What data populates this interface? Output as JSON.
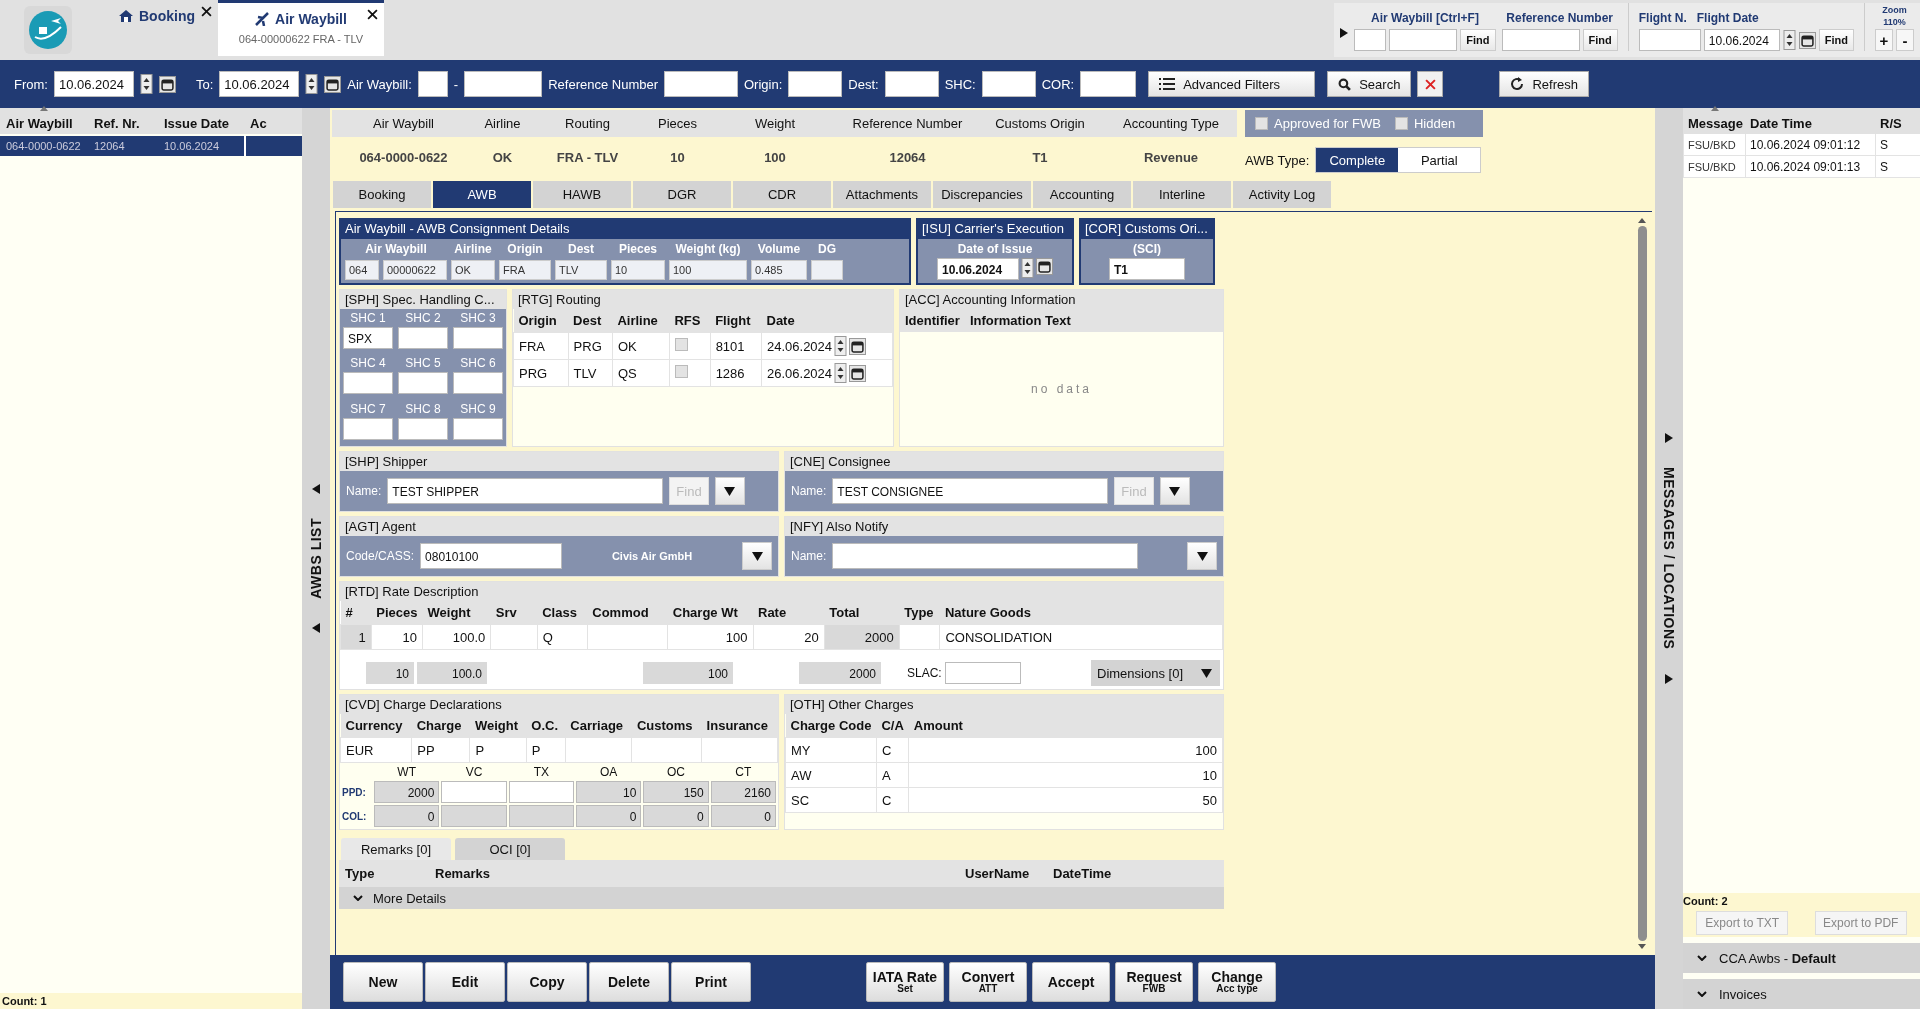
{
  "app_tabs": [
    {
      "kind": "booking",
      "label": "Booking",
      "selected": false
    },
    {
      "kind": "awb",
      "label": "Air Waybill",
      "subtitle": "064-00000622 FRA - TLV",
      "selected": true
    }
  ],
  "quick_search": {
    "awb_label": "Air Waybill [Ctrl+F]",
    "ref_label": "Reference Number",
    "flight_label": "Flight N.",
    "date_label": "Flight Date",
    "date_value": "10.06.2024",
    "find_buttons": [
      "Find",
      "Find",
      "Find"
    ],
    "zoom_label": "Zoom",
    "zoom_value": "110%",
    "zoom_in": "+",
    "zoom_out": "-"
  },
  "filter_bar": {
    "from_label": "From:",
    "from": "10.06.2024",
    "to_label": "To:",
    "to": "10.06.2024",
    "awb_label": "Air Waybill:",
    "awb_dash": "-",
    "ref_label": "Reference Number",
    "origin_label": "Origin:",
    "dest_label": "Dest:",
    "shc_label": "SHC:",
    "cor_label": "COR:",
    "advanced": "Advanced Filters",
    "search": "Search",
    "refresh": "Refresh"
  },
  "awb_list": {
    "columns": [
      "Air Waybill",
      "Ref. Nr.",
      "Issue Date",
      "Ac"
    ],
    "rows": [
      {
        "awb": "064-0000-0622",
        "ref": "12064",
        "date": "10.06.2024",
        "selected": true
      }
    ],
    "count": "Count: 1",
    "splitter_label": "AWBS LIST"
  },
  "summary": {
    "columns": [
      "Air Waybill",
      "Airline",
      "Routing",
      "Pieces",
      "Weight",
      "Reference Number",
      "Customs Origin",
      "Accounting Type"
    ],
    "values": [
      "064-0000-0622",
      "OK",
      "FRA - TLV",
      "10",
      "100",
      "12064",
      "T1",
      "Revenue"
    ]
  },
  "flags": [
    {
      "label": "Approved for FWB",
      "checked": false
    },
    {
      "label": "Hidden",
      "checked": false
    }
  ],
  "awb_type": {
    "label": "AWB Type:",
    "options": [
      {
        "label": "Complete",
        "selected": true
      },
      {
        "label": "Partial",
        "selected": false
      }
    ]
  },
  "detail_tabs": [
    {
      "label": "Booking",
      "selected": false
    },
    {
      "label": "AWB",
      "selected": true
    },
    {
      "label": "HAWB",
      "selected": false
    },
    {
      "label": "DGR",
      "selected": false
    },
    {
      "label": "CDR",
      "selected": false
    },
    {
      "label": "Attachments",
      "selected": false
    },
    {
      "label": "Discrepancies",
      "selected": false
    },
    {
      "label": "Accounting",
      "selected": false
    },
    {
      "label": "Interline",
      "selected": false
    },
    {
      "label": "Activity Log",
      "selected": false
    }
  ],
  "consignment": {
    "title": "Air Waybill - AWB Consignment Details",
    "columns": [
      "Air Waybill",
      "Airline",
      "Origin",
      "Dest",
      "Pieces",
      "Weight (kg)",
      "Volume",
      "DG"
    ],
    "values": [
      "064",
      "00000622",
      "OK",
      "FRA",
      "TLV",
      "10",
      "100",
      "0.485"
    ]
  },
  "issue": {
    "title": "[ISU] Carrier's Execution",
    "label": "Date of Issue",
    "value": "10.06.2024"
  },
  "customs_origin": {
    "title": "[COR] Customs Ori...",
    "label": "(SCI)",
    "value": "T1"
  },
  "special_handling": {
    "title": "[SPH] Spec. Handling C...",
    "codes": [
      {
        "label": "SHC 1",
        "value": "SPX"
      },
      {
        "label": "SHC 2"
      },
      {
        "label": "SHC 3"
      },
      {
        "label": "SHC 4"
      },
      {
        "label": "SHC 5"
      },
      {
        "label": "SHC 6"
      },
      {
        "label": "SHC 7"
      },
      {
        "label": "SHC 8"
      },
      {
        "label": "SHC 9"
      }
    ]
  },
  "routing": {
    "title": "[RTG] Routing",
    "columns": [
      "Origin",
      "Dest",
      "Airline",
      "RFS",
      "Flight",
      "Date"
    ],
    "rows": [
      {
        "origin": "FRA",
        "dest": "PRG",
        "airline": "OK",
        "rfs": false,
        "flight": "8101",
        "date": "24.06.2024"
      },
      {
        "origin": "PRG",
        "dest": "TLV",
        "airline": "QS",
        "rfs": false,
        "flight": "1286",
        "date": "26.06.2024"
      }
    ]
  },
  "accounting": {
    "title": "[ACC] Accounting Information",
    "columns": [
      "Identifier",
      "Information Text"
    ],
    "empty": "no data"
  },
  "shipper": {
    "title": "[SHP] Shipper",
    "label": "Name:",
    "value": "TEST SHIPPER",
    "find": "Find"
  },
  "consignee": {
    "title": "[CNE] Consignee",
    "label": "Name:",
    "value": "TEST CONSIGNEE",
    "find": "Find"
  },
  "agent": {
    "title": "[AGT] Agent",
    "label": "Code/CASS:",
    "value": "08010100",
    "name": "Civis Air GmbH"
  },
  "notify": {
    "title": "[NFY] Also Notify",
    "label": "Name:"
  },
  "rates": {
    "title": "[RTD] Rate Description",
    "columns": [
      "#",
      "Pieces",
      "Weight",
      "Srv",
      "Class",
      "Commod",
      "Charge Wt",
      "Rate",
      "Total",
      "Type",
      "Nature Goods"
    ],
    "rows": [
      {
        "no": "1",
        "pieces": "10",
        "weight": "100.0",
        "class": "Q",
        "charge_wt": "100",
        "rate": "20",
        "total": "2000",
        "nature": "CONSOLIDATION"
      }
    ],
    "totals": {
      "pieces": "10",
      "weight": "100.0",
      "charge_wt": "100",
      "total": "2000"
    },
    "slac_label": "SLAC:",
    "dimensions": "Dimensions [0]"
  },
  "charges": {
    "title": "[CVD] Charge Declarations",
    "columns": [
      "Currency",
      "Charge",
      "Weight",
      "O.C.",
      "Carriage",
      "Customs",
      "Insurance"
    ],
    "values": {
      "currency": "EUR",
      "charge": "PP",
      "weight": "P",
      "oc": "P"
    },
    "summary_columns": [
      "WT",
      "VC",
      "TX",
      "OA",
      "OC",
      "CT"
    ],
    "summary_rows": [
      {
        "label": "PPD:",
        "values": {
          "wt": "2000",
          "oa": "10",
          "oc": "150",
          "ct": "2160"
        }
      },
      {
        "label": "COL:",
        "values": {
          "wt": "0",
          "oa": "0",
          "oc": "0",
          "ct": "0"
        }
      }
    ]
  },
  "other_charges": {
    "title": "[OTH] Other Charges",
    "columns": [
      "Charge Code",
      "C/A",
      "Amount"
    ],
    "rows": [
      {
        "code": "MY",
        "ca": "C",
        "amount": "100"
      },
      {
        "code": "AW",
        "ca": "A",
        "amount": "10"
      },
      {
        "code": "SC",
        "ca": "C",
        "amount": "50"
      }
    ]
  },
  "remarks": {
    "tabs": [
      {
        "label": "Remarks [0]",
        "selected": true
      },
      {
        "label": "OCI [0]",
        "selected": false
      }
    ],
    "columns": [
      "Type",
      "Remarks",
      "UserName",
      "DateTime"
    ],
    "more": "More Details"
  },
  "actions": [
    {
      "label": "New"
    },
    {
      "label": "Edit"
    },
    {
      "label": "Copy"
    },
    {
      "label": "Delete"
    },
    {
      "label": "Print"
    }
  ],
  "actions_2": [
    {
      "label": "IATA Rate",
      "sub": "Set"
    },
    {
      "label": "Convert",
      "sub": "ATT"
    },
    {
      "label": "Accept"
    },
    {
      "label": "Request",
      "sub": "FWB"
    },
    {
      "label": "Change",
      "sub": "Acc type"
    }
  ],
  "messages": {
    "splitter_label": "MESSAGES / LOCATIONS",
    "columns": [
      "Message",
      "Date Time",
      "R/S"
    ],
    "rows": [
      {
        "message": "FSU/BKD",
        "datetime": "10.06.2024 09:01:12",
        "rs": "S"
      },
      {
        "message": "FSU/BKD",
        "datetime": "10.06.2024 09:01:13",
        "rs": "S"
      }
    ],
    "count": "Count: 2",
    "exports": [
      {
        "label": "Export to TXT",
        "disabled": true
      },
      {
        "label": "Export to PDF",
        "disabled": true
      }
    ],
    "sections": [
      {
        "label": "CCA Awbs - **Default**"
      },
      {
        "label": "Invoices"
      }
    ]
  }
}
